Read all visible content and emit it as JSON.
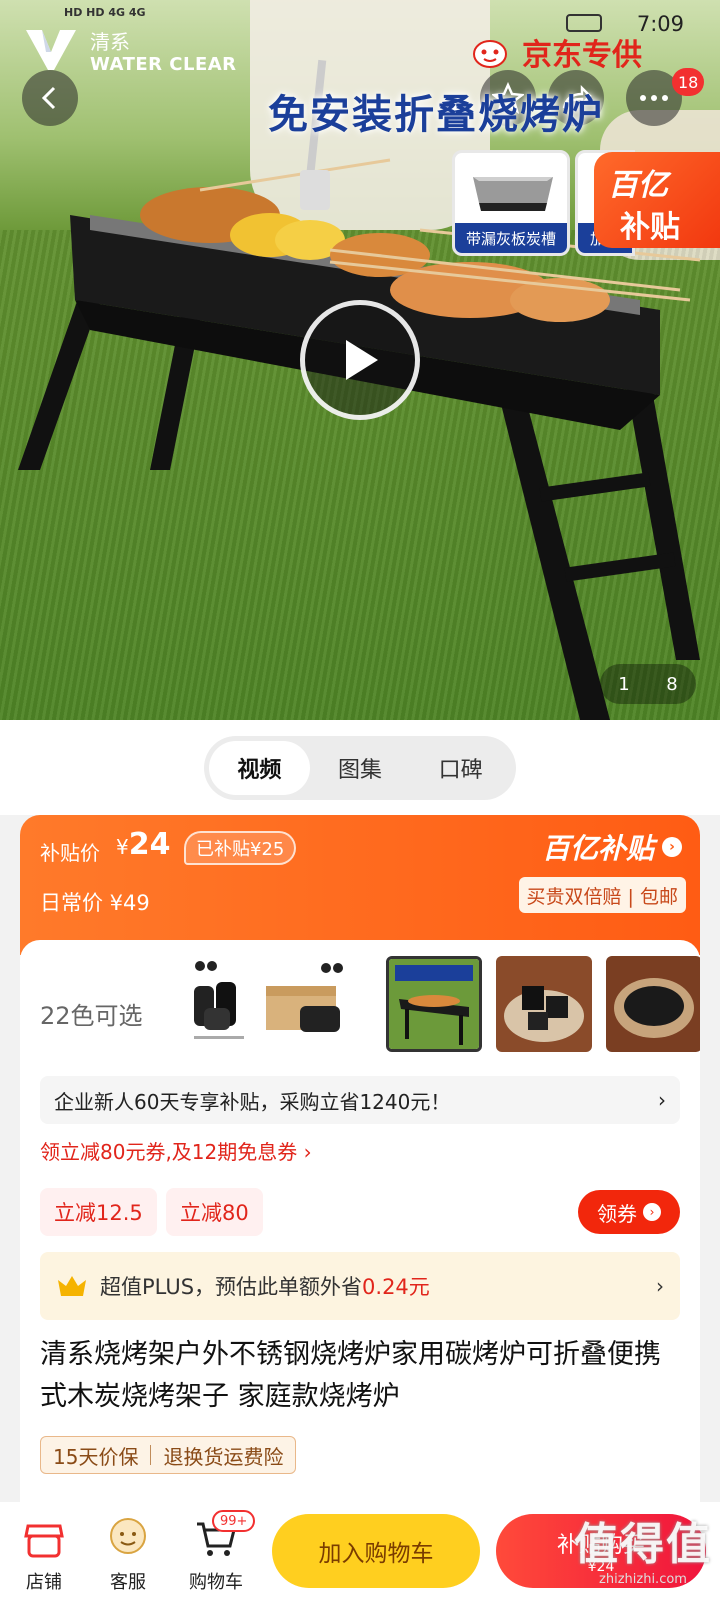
{
  "status_bar": {
    "time": "7:09",
    "signal_text": "HD HD 4G 4G"
  },
  "brand": {
    "name_cn": "清系",
    "name_en": "WATER CLEAR"
  },
  "hero": {
    "badge_count": "18",
    "jd_tag": "京东专供",
    "headline": "免安装折叠烧烤炉",
    "inset_caption": "带漏灰板炭槽",
    "inset2_caption": "加",
    "corner_line1": "百亿",
    "corner_line2": "补贴",
    "pager_current": "1",
    "pager_total": "8"
  },
  "media_tabs": [
    "视频",
    "图集",
    "口碑"
  ],
  "price_banner": {
    "subsidy_label": "补贴价",
    "currency": "¥",
    "subsidy_price": "24",
    "saved_badge": "已补贴¥25",
    "regular_label": "日常价 ¥49",
    "program_name": "百亿补贴",
    "guarantee": "买贵双倍赔 | 包邮"
  },
  "options": {
    "colors_label": "22色可选"
  },
  "promotions": {
    "business_newcomer": "企业新人60天专享补贴，采购立省1240元！",
    "coupon_link": "领立减80元券,及12期免息券 ›",
    "chips": [
      "立减12.5",
      "立减80"
    ],
    "get_coupon": "领券",
    "plus_prefix": "超值PLUS，预估此单额外省",
    "plus_amount": "0.24元"
  },
  "product": {
    "title": "清系烧烤架户外不锈钢烧烤炉家用碳烤炉可折叠便携式木炭烧烤架子 家庭款烧烤炉",
    "service_tags": [
      "15天价保",
      "退换货运费险"
    ]
  },
  "bottom_bar": {
    "store": "店铺",
    "service": "客服",
    "cart": "购物车",
    "cart_badge": "99+",
    "add_to_cart": "加入购物车",
    "buy_line1": "补贴购买",
    "buy_line2": "¥24"
  },
  "watermark": {
    "big": "值得值",
    "small": "zhizhizhi.com"
  },
  "colors": {
    "accent": "#f2270c",
    "banner_orange": "#ff5c14",
    "cart_yellow": "#ffcf1f"
  }
}
